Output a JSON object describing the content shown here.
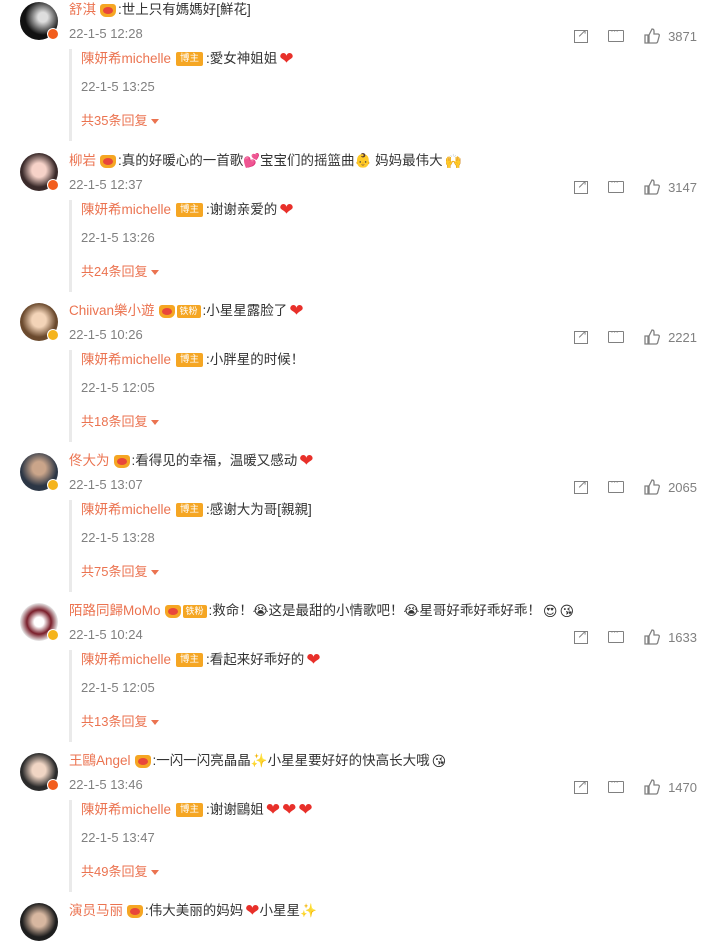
{
  "comments": [
    {
      "user": "舒淇",
      "text": ":世上只有媽媽好[鮮花]",
      "fan_badge": "",
      "time": "22-1-5 12:28",
      "likes": "3871",
      "reply": {
        "user": "陳妍希michelle",
        "badge": "博主",
        "text": ":愛女神姐姐",
        "time": "22-1-5 13:25",
        "more": "共35条回复"
      }
    },
    {
      "user": "柳岩",
      "text": ":真的好暖心的一首歌💕宝宝们的摇篮曲👶 妈妈最伟大",
      "fan_badge": "",
      "time": "22-1-5 12:37",
      "likes": "3147",
      "reply": {
        "user": "陳妍希michelle",
        "badge": "博主",
        "text": ":谢谢亲爱的",
        "time": "22-1-5 13:26",
        "more": "共24条回复"
      }
    },
    {
      "user": "Chiivan樂小遊",
      "text": ":小星星露脸了",
      "fan_badge": "铁粉",
      "time": "22-1-5 10:26",
      "likes": "2221",
      "reply": {
        "user": "陳妍希michelle",
        "badge": "博主",
        "text": ":小胖星的时候！",
        "time": "22-1-5 12:05",
        "more": "共18条回复"
      }
    },
    {
      "user": "佟大为",
      "text": ":看得见的幸福，温暖又感动",
      "fan_badge": "",
      "time": "22-1-5 13:07",
      "likes": "2065",
      "reply": {
        "user": "陳妍希michelle",
        "badge": "博主",
        "text": ":感谢大为哥[親親]",
        "time": "22-1-5 13:28",
        "more": "共75条回复"
      }
    },
    {
      "user": "陌路同歸MoMo",
      "text": ":救命！😭这是最甜的小情歌吧！😭星哥好乖好乖好乖！",
      "fan_badge": "铁粉",
      "time": "22-1-5 10:24",
      "likes": "1633",
      "reply": {
        "user": "陳妍希michelle",
        "badge": "博主",
        "text": ":看起来好乖好的",
        "time": "22-1-5 12:05",
        "more": "共13条回复"
      }
    },
    {
      "user": "王鷗Angel",
      "text": ":一闪一闪亮晶晶✨小星星要好好的快高长大哦",
      "fan_badge": "",
      "time": "22-1-5 13:46",
      "likes": "1470",
      "reply": {
        "user": "陳妍希michelle",
        "badge": "博主",
        "text": ":谢谢鷗姐",
        "time": "22-1-5 13:47",
        "more": "共49条回复"
      }
    },
    {
      "user": "演员马丽",
      "text": ":伟大美丽的妈妈",
      "text2": "小星星✨",
      "fan_badge": "",
      "time": "",
      "likes": ""
    }
  ],
  "icons": {
    "share": "share-icon",
    "comment": "comment-icon",
    "like": "thumbs-up-icon",
    "expand": "caret-down-icon"
  },
  "colors": {
    "username": "#eb7350",
    "blogger_badge": "#f5a623",
    "meta": "#808080",
    "heart": "#e8302a"
  }
}
